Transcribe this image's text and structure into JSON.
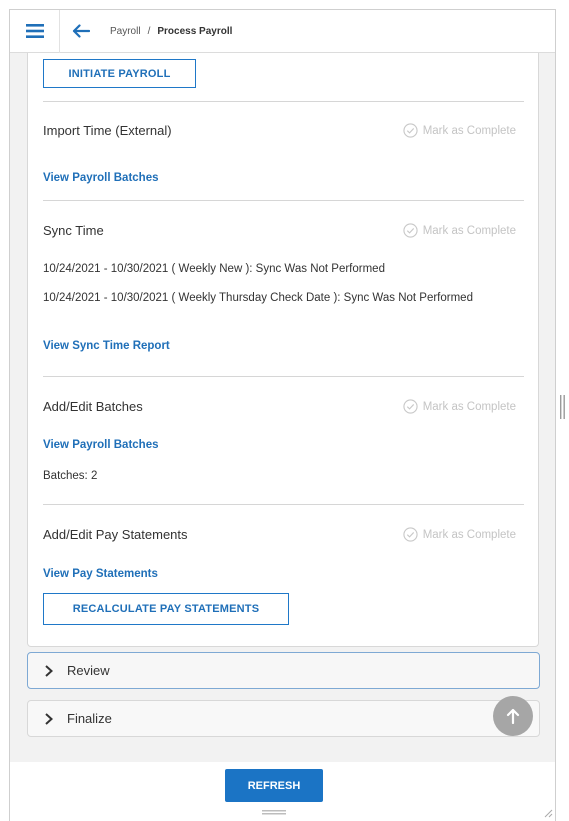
{
  "header": {
    "menu_icon": "hamburger-icon",
    "back_icon": "arrow-left-icon",
    "breadcrumb_parent": "Payroll",
    "breadcrumb_separator": "/",
    "breadcrumb_current": "Process Payroll"
  },
  "initiate_button_label": "INITIATE PAYROLL",
  "mark_complete_label": "Mark as Complete",
  "steps": {
    "import_time": {
      "title": "Import Time (External)",
      "link": "View Payroll Batches"
    },
    "sync_time": {
      "title": "Sync Time",
      "line1": "10/24/2021 - 10/30/2021 ( Weekly New ): Sync Was Not Performed",
      "line2": "10/24/2021 - 10/30/2021 ( Weekly Thursday Check Date ): Sync Was Not Performed",
      "link": "View Sync Time Report"
    },
    "add_edit_batches": {
      "title": "Add/Edit Batches",
      "link": "View Payroll Batches",
      "batches_text": "Batches: 2"
    },
    "add_edit_pay_statements": {
      "title": "Add/Edit Pay Statements",
      "link": "View Pay Statements",
      "recalculate_label": "RECALCULATE PAY STATEMENTS"
    }
  },
  "accordions": {
    "review": "Review",
    "finalize": "Finalize"
  },
  "refresh_label": "REFRESH",
  "colors": {
    "accent": "#1b74c5",
    "link": "#1f6fb8",
    "muted": "#c4c4c4"
  }
}
